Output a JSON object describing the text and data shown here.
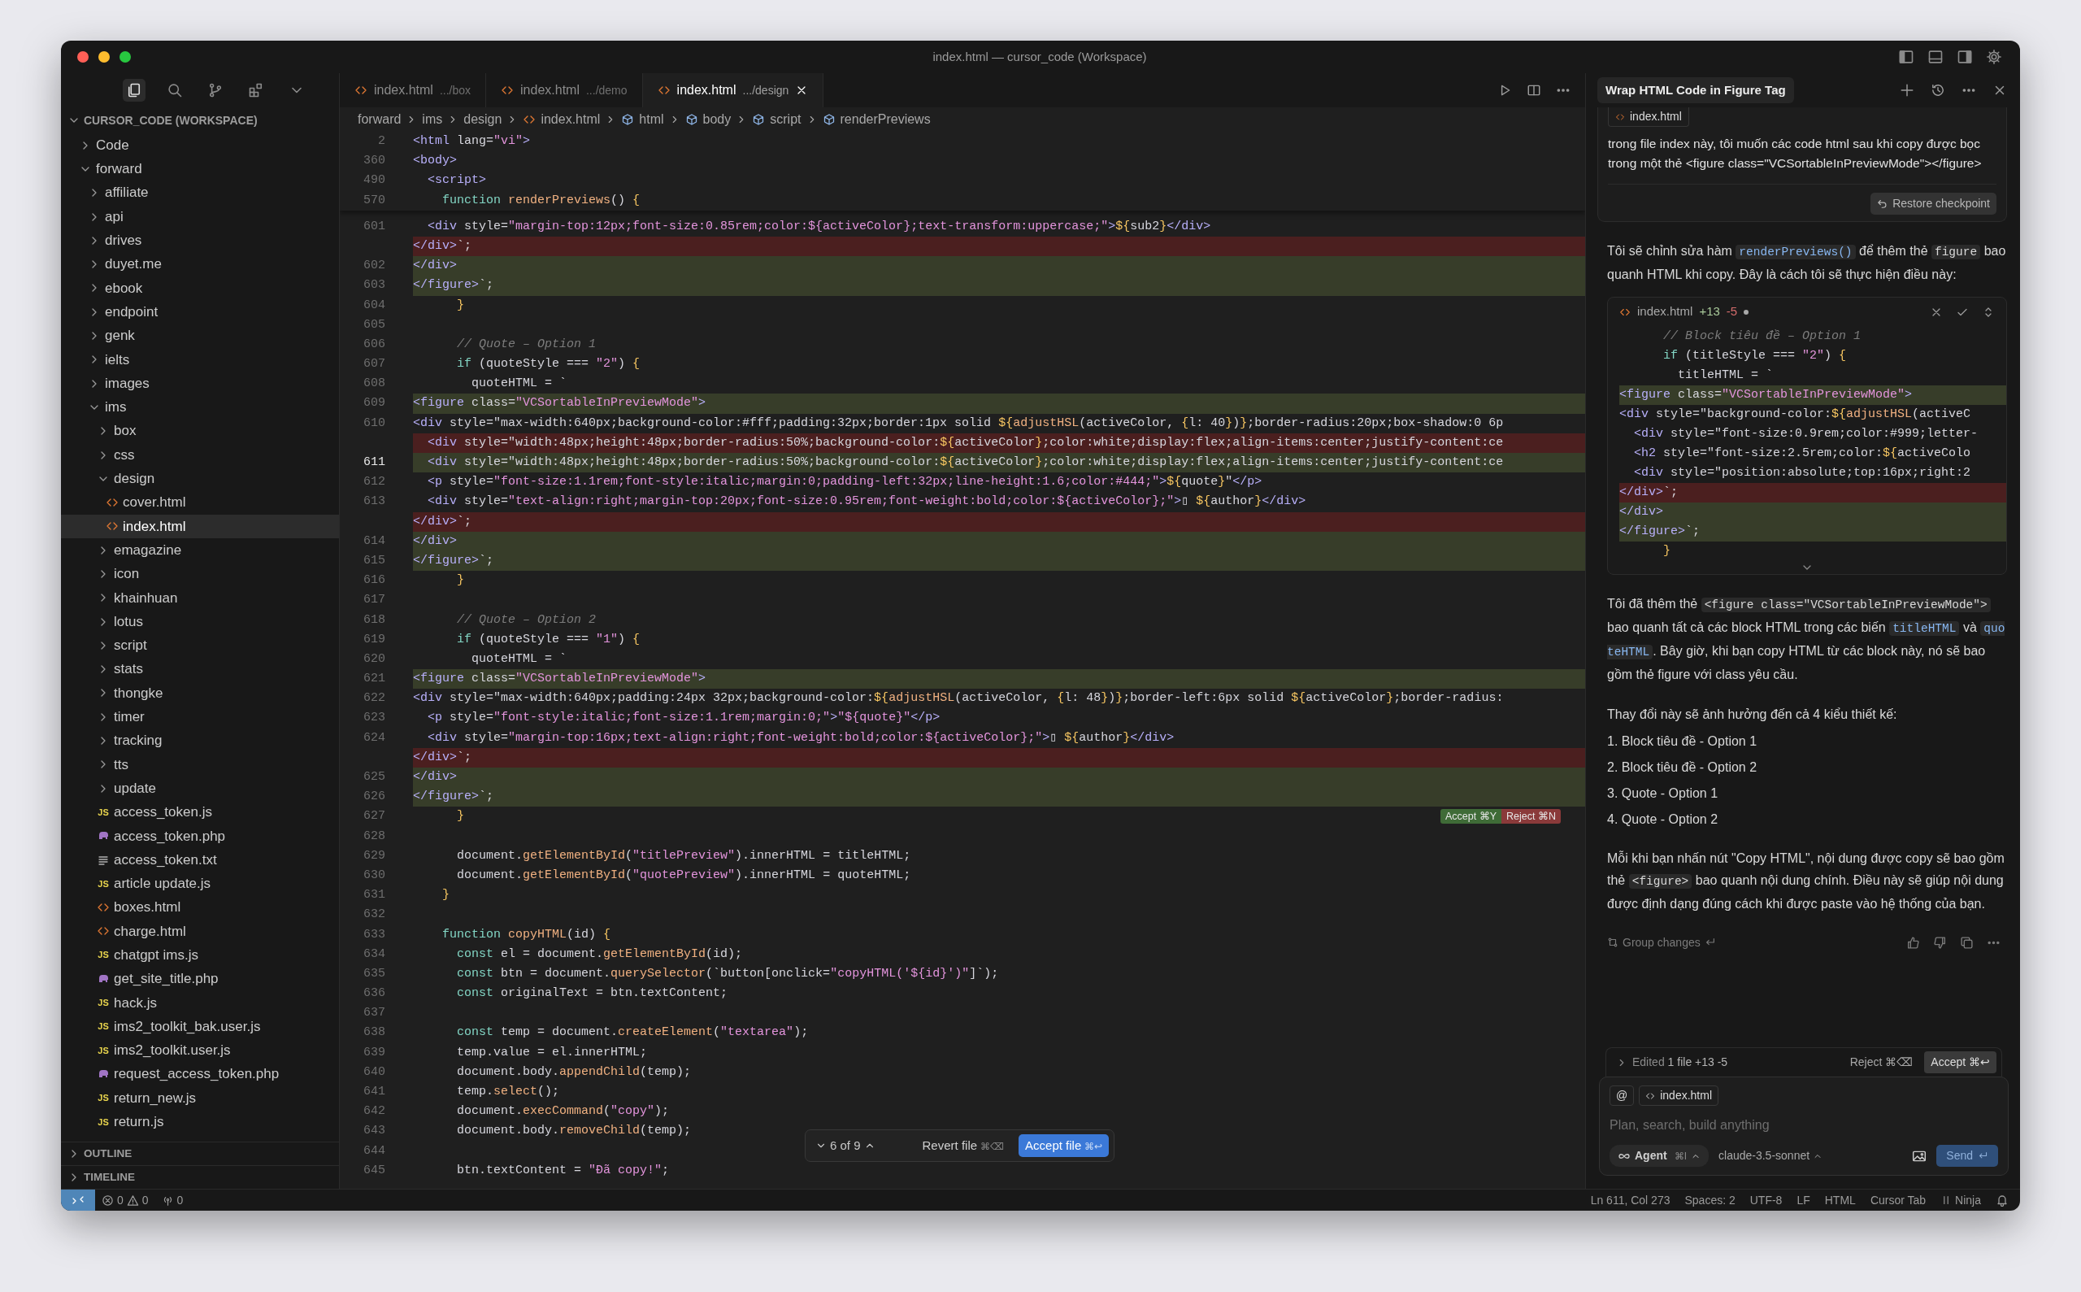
{
  "window": {
    "title": "index.html — cursor_code (Workspace)"
  },
  "activity_bar": [
    {
      "kind": "files",
      "selected": true
    },
    {
      "kind": "search",
      "selected": false
    },
    {
      "kind": "source-control",
      "selected": false
    },
    {
      "kind": "extensions",
      "selected": false
    },
    {
      "kind": "more",
      "selected": false
    }
  ],
  "explorer": {
    "title": "CURSOR_CODE (WORKSPACE)",
    "expanded": true,
    "tree": [
      {
        "label": "Code",
        "kind": "folder",
        "expanded": false,
        "selected": false
      },
      {
        "label": "forward",
        "kind": "folder",
        "expanded": true,
        "selected": false,
        "children": [
          {
            "label": "affiliate",
            "kind": "folder",
            "expanded": false,
            "selected": false
          },
          {
            "label": "api",
            "kind": "folder",
            "expanded": false,
            "selected": false
          },
          {
            "label": "drives",
            "kind": "folder",
            "expanded": false,
            "selected": false
          },
          {
            "label": "duyet.me",
            "kind": "folder",
            "expanded": false,
            "selected": false
          },
          {
            "label": "ebook",
            "kind": "folder",
            "expanded": false,
            "selected": false
          },
          {
            "label": "endpoint",
            "kind": "folder",
            "expanded": false,
            "selected": false
          },
          {
            "label": "genk",
            "kind": "folder",
            "expanded": false,
            "selected": false
          },
          {
            "label": "ielts",
            "kind": "folder",
            "expanded": false,
            "selected": false
          },
          {
            "label": "images",
            "kind": "folder",
            "expanded": false,
            "selected": false
          },
          {
            "label": "ims",
            "kind": "folder",
            "expanded": true,
            "selected": false,
            "children": [
              {
                "label": "box",
                "kind": "folder",
                "expanded": false,
                "selected": false
              },
              {
                "label": "css",
                "kind": "folder",
                "expanded": false,
                "selected": false
              },
              {
                "label": "design",
                "kind": "folder",
                "expanded": true,
                "selected": false,
                "children": [
                  {
                    "label": "cover.html",
                    "kind": "html",
                    "selected": false
                  },
                  {
                    "label": "index.html",
                    "kind": "html",
                    "selected": true
                  }
                ]
              },
              {
                "label": "emagazine",
                "kind": "folder",
                "expanded": false,
                "selected": false
              },
              {
                "label": "icon",
                "kind": "folder",
                "expanded": false,
                "selected": false
              },
              {
                "label": "khainhuan",
                "kind": "folder",
                "expanded": false,
                "selected": false
              },
              {
                "label": "lotus",
                "kind": "folder",
                "expanded": false,
                "selected": false
              },
              {
                "label": "script",
                "kind": "folder",
                "expanded": false,
                "selected": false
              },
              {
                "label": "stats",
                "kind": "folder",
                "expanded": false,
                "selected": false
              },
              {
                "label": "thongke",
                "kind": "folder",
                "expanded": false,
                "selected": false
              },
              {
                "label": "timer",
                "kind": "folder",
                "expanded": false,
                "selected": false
              },
              {
                "label": "tracking",
                "kind": "folder",
                "expanded": false,
                "selected": false
              },
              {
                "label": "tts",
                "kind": "folder",
                "expanded": false,
                "selected": false
              },
              {
                "label": "update",
                "kind": "folder",
                "expanded": false,
                "selected": false
              },
              {
                "label": "access_token.js",
                "kind": "js",
                "icon_label": "JS",
                "selected": false
              },
              {
                "label": "access_token.php",
                "kind": "php",
                "selected": false
              },
              {
                "label": "access_token.txt",
                "kind": "txt",
                "selected": false
              },
              {
                "label": "article update.js",
                "kind": "js",
                "icon_label": "JS",
                "selected": false
              },
              {
                "label": "boxes.html",
                "kind": "html",
                "selected": false
              },
              {
                "label": "charge.html",
                "kind": "html",
                "selected": false
              },
              {
                "label": "chatgpt ims.js",
                "kind": "js",
                "icon_label": "JS",
                "selected": false
              },
              {
                "label": "get_site_title.php",
                "kind": "php",
                "selected": false
              },
              {
                "label": "hack.js",
                "kind": "js",
                "icon_label": "JS",
                "selected": false
              },
              {
                "label": "ims2_toolkit_bak.user.js",
                "kind": "js",
                "icon_label": "JS",
                "selected": false
              },
              {
                "label": "ims2_toolkit.user.js",
                "kind": "js",
                "icon_label": "JS",
                "selected": false
              },
              {
                "label": "request_access_token.php",
                "kind": "php",
                "selected": false
              },
              {
                "label": "return_new.js",
                "kind": "js",
                "icon_label": "JS",
                "selected": false
              },
              {
                "label": "return.js",
                "kind": "js",
                "icon_label": "JS",
                "selected": false
              }
            ]
          }
        ]
      }
    ],
    "sections": [
      {
        "title": "OUTLINE",
        "expanded": false
      },
      {
        "title": "TIMELINE",
        "expanded": false
      }
    ]
  },
  "tabs": [
    {
      "name": "index.html",
      "path": ".../box",
      "selected": false
    },
    {
      "name": "index.html",
      "path": ".../demo",
      "selected": false
    },
    {
      "name": "index.html",
      "path": ".../design",
      "selected": true
    }
  ],
  "breadcrumbs": [
    {
      "label": "forward",
      "kind": "folder"
    },
    {
      "label": "ims",
      "kind": "folder"
    },
    {
      "label": "design",
      "kind": "folder"
    },
    {
      "label": "index.html",
      "kind": "file"
    },
    {
      "label": "html",
      "kind": "element"
    },
    {
      "label": "body",
      "kind": "element"
    },
    {
      "label": "script",
      "kind": "element"
    },
    {
      "label": "renderPreviews",
      "kind": "element"
    }
  ],
  "editor": {
    "sticky_lines": [
      {
        "num": "2",
        "text": "<html lang=\"vi\">"
      },
      {
        "num": "360",
        "text": "<body>"
      },
      {
        "num": "490",
        "text": "  <script>"
      },
      {
        "num": "570",
        "text": "    function renderPreviews() {"
      }
    ],
    "lines": [
      {
        "num": "601",
        "text": "  <div style=\"margin-top:12px;font-size:0.85rem;color:${activeColor};text-transform:uppercase;\">${sub2}</div>",
        "added": false,
        "removed": false,
        "current": false
      },
      {
        "text": "</div>`;",
        "added": false,
        "removed": true
      },
      {
        "num": "602",
        "text": "</div>",
        "added": true,
        "removed": false,
        "current": false
      },
      {
        "num": "603",
        "text": "</figure>`;",
        "added": true,
        "removed": false,
        "current": false
      },
      {
        "num": "604",
        "text": "      }",
        "added": false,
        "removed": false,
        "current": false
      },
      {
        "num": "605",
        "added": false,
        "removed": false,
        "current": false
      },
      {
        "num": "606",
        "text": "      // Quote – Option 1",
        "added": false,
        "removed": false,
        "current": false
      },
      {
        "num": "607",
        "text": "      if (quoteStyle === \"2\") {",
        "added": false,
        "removed": false,
        "current": false
      },
      {
        "num": "608",
        "text": "        quoteHTML = `",
        "added": false,
        "removed": false,
        "current": false
      },
      {
        "num": "609",
        "text": "<figure class=\"VCSortableInPreviewMode\">",
        "added": true,
        "removed": false,
        "current": false
      },
      {
        "num": "610",
        "text": "<div style=\"max-width:640px;background-color:#fff;padding:32px;border:1px solid ${adjustHSL(activeColor, {l: 40})};border-radius:20px;box-shadow:0 6p",
        "added": false,
        "removed": false,
        "current": false
      },
      {
        "text": "  <div style=\"width:48px;height:48px;border-radius:50%;background-color:${activeColor};color:white;display:flex;align-items:center;justify-content:ce",
        "added": false,
        "removed": true
      },
      {
        "num": "611",
        "text": "  <div style=\"width:48px;height:48px;border-radius:50%;background-color:${activeColor};color:white;display:flex;align-items:center;justify-content:ce",
        "added": true,
        "removed": false,
        "current": true
      },
      {
        "num": "612",
        "text": "  <p style=\"font-size:1.1rem;font-style:italic;margin:0;padding-left:32px;line-height:1.6;color:#444;\">${quote}\"</p>",
        "added": false,
        "removed": false,
        "current": false
      },
      {
        "num": "613",
        "text": "  <div style=\"text-align:right;margin-top:20px;font-size:0.95rem;font-weight:bold;color:${activeColor};\">▯ ${author}</div>",
        "added": false,
        "removed": false,
        "current": false
      },
      {
        "text": "</div>`;",
        "added": false,
        "removed": true
      },
      {
        "num": "614",
        "text": "</div>",
        "added": true,
        "removed": false,
        "current": false
      },
      {
        "num": "615",
        "text": "</figure>`;",
        "added": true,
        "removed": false,
        "current": false
      },
      {
        "num": "616",
        "text": "      }",
        "added": false,
        "removed": false,
        "current": false
      },
      {
        "num": "617",
        "added": false,
        "removed": false,
        "current": false
      },
      {
        "num": "618",
        "text": "      // Quote – Option 2",
        "added": false,
        "removed": false,
        "current": false
      },
      {
        "num": "619",
        "text": "      if (quoteStyle === \"1\") {",
        "added": false,
        "removed": false,
        "current": false
      },
      {
        "num": "620",
        "text": "        quoteHTML = `",
        "added": false,
        "removed": false,
        "current": false
      },
      {
        "num": "621",
        "text": "<figure class=\"VCSortableInPreviewMode\">",
        "added": true,
        "removed": false,
        "current": false
      },
      {
        "num": "622",
        "text": "<div style=\"max-width:640px;padding:24px 32px;background-color:${adjustHSL(activeColor, {l: 48})};border-left:6px solid ${activeColor};border-radius:",
        "added": false,
        "removed": false,
        "current": false
      },
      {
        "num": "623",
        "text": "  <p style=\"font-style:italic;font-size:1.1rem;margin:0;\">\"${quote}\"</p>",
        "added": false,
        "removed": false,
        "current": false
      },
      {
        "num": "624",
        "text": "  <div style=\"margin-top:16px;text-align:right;font-weight:bold;color:${activeColor};\">▯ ${author}</div>",
        "added": false,
        "removed": false,
        "current": false
      },
      {
        "text": "</div>`;",
        "added": false,
        "removed": true
      },
      {
        "num": "625",
        "text": "</div>",
        "added": true,
        "removed": false,
        "current": false
      },
      {
        "num": "626",
        "text": "</figure>`;",
        "added": true,
        "removed": false,
        "current": false
      },
      {
        "num": "627",
        "text": "      }",
        "added": false,
        "removed": false,
        "current": false,
        "actions": [
          {
            "kind": "accept",
            "label": "Accept ⌘Y"
          },
          {
            "kind": "reject",
            "label": "Reject ⌘N"
          }
        ]
      },
      {
        "num": "628",
        "added": false,
        "removed": false,
        "current": false
      },
      {
        "num": "629",
        "text": "      document.getElementById(\"titlePreview\").innerHTML = titleHTML;",
        "added": false,
        "removed": false,
        "current": false
      },
      {
        "num": "630",
        "text": "      document.getElementById(\"quotePreview\").innerHTML = quoteHTML;",
        "added": false,
        "removed": false,
        "current": false
      },
      {
        "num": "631",
        "text": "    }",
        "added": false,
        "removed": false,
        "current": false
      },
      {
        "num": "632",
        "added": false,
        "removed": false,
        "current": false
      },
      {
        "num": "633",
        "text": "    function copyHTML(id) {",
        "added": false,
        "removed": false,
        "current": false
      },
      {
        "num": "634",
        "text": "      const el = document.getElementById(id);",
        "added": false,
        "removed": false,
        "current": false
      },
      {
        "num": "635",
        "text": "      const btn = document.querySelector(`button[onclick=\"copyHTML('${id}')\"]`);",
        "added": false,
        "removed": false,
        "current": false
      },
      {
        "num": "636",
        "text": "      const originalText = btn.textContent;",
        "added": false,
        "removed": false,
        "current": false
      },
      {
        "num": "637",
        "added": false,
        "removed": false,
        "current": false
      },
      {
        "num": "638",
        "text": "      const temp = document.createElement(\"textarea\");",
        "added": false,
        "removed": false,
        "current": false
      },
      {
        "num": "639",
        "text": "      temp.value = el.innerHTML;",
        "added": false,
        "removed": false,
        "current": false
      },
      {
        "num": "640",
        "text": "      document.body.appendChild(temp);",
        "added": false,
        "removed": false,
        "current": false
      },
      {
        "num": "641",
        "text": "      temp.select();",
        "added": false,
        "removed": false,
        "current": false
      },
      {
        "num": "642",
        "text": "      document.execCommand(\"copy\");",
        "added": false,
        "removed": false,
        "current": false
      },
      {
        "num": "643",
        "text": "      document.body.removeChild(temp);",
        "added": false,
        "removed": false,
        "current": false
      },
      {
        "num": "644",
        "added": false,
        "removed": false,
        "current": false
      },
      {
        "num": "645",
        "text": "      btn.textContent = \"Đã copy!\";",
        "added": false,
        "removed": false,
        "current": false
      }
    ],
    "diff_nav": {
      "position": "6 of 9",
      "revert": {
        "label": "Revert file",
        "shortcut": "⌘⌫"
      },
      "accept": {
        "label": "Accept file",
        "shortcut": "⌘↩"
      }
    }
  },
  "chat": {
    "title": "Wrap HTML Code in Figure Tag",
    "user_message": {
      "file_chip": "index.html",
      "text": "trong file index này, tôi muốn các code html sau khi copy được bọc trong một thẻ <figure class=\"VCSortableInPreviewMode\"></figure>",
      "restore": "Restore checkpoint"
    },
    "assistant": [
      {
        "kind": "paragraph",
        "parts": [
          {
            "kind": "text",
            "text": "Tôi sẽ chỉnh sửa hàm "
          },
          {
            "kind": "symbol",
            "text": "renderPreviews()"
          },
          {
            "kind": "text",
            "text": " để thêm thẻ "
          },
          {
            "kind": "code",
            "text": "figure"
          },
          {
            "kind": "text",
            "text": " bao quanh HTML khi copy. Đây là cách tôi sẽ thực hiện điều này:"
          }
        ]
      },
      {
        "kind": "code_block",
        "file": "index.html",
        "added": "+13",
        "removed": "-5",
        "lines": [
          {
            "text": "      // Block tiêu đề – Option 1",
            "added": false,
            "removed": false
          },
          {
            "text": "      if (titleStyle === \"2\") {",
            "added": false,
            "removed": false
          },
          {
            "text": "        titleHTML = `",
            "added": false,
            "removed": false
          },
          {
            "text": "<figure class=\"VCSortableInPreviewMode\">",
            "added": true,
            "removed": false
          },
          {
            "text": "<div style=\"background-color:${adjustHSL(activeC",
            "added": false,
            "removed": false
          },
          {
            "text": "  <div style=\"font-size:0.9rem;color:#999;letter-",
            "added": false,
            "removed": false
          },
          {
            "text": "  <h2 style=\"font-size:2.5rem;color:${activeColo",
            "added": false,
            "removed": false
          },
          {
            "text": "  <div style=\"position:absolute;top:16px;right:2",
            "added": false,
            "removed": false
          },
          {
            "text": "</div>`;",
            "added": false,
            "removed": true
          },
          {
            "text": "</div>",
            "added": true,
            "removed": false
          },
          {
            "text": "</figure>`;",
            "added": true,
            "removed": false
          },
          {
            "text": "      }",
            "added": false,
            "removed": false
          }
        ]
      },
      {
        "kind": "paragraph",
        "parts": [
          {
            "kind": "text",
            "text": "Tôi đã thêm thẻ "
          },
          {
            "kind": "code",
            "text": "<figure class=\"VCSortableInPreviewMode\">"
          },
          {
            "kind": "text",
            "text": " bao quanh tất cả các block HTML trong các biến "
          },
          {
            "kind": "symbol",
            "text": "titleHTML"
          },
          {
            "kind": "text",
            "text": " và "
          },
          {
            "kind": "symbol",
            "text": "quoteHTML"
          },
          {
            "kind": "text",
            "text": ". Bây giờ, khi bạn copy HTML từ các block này, nó sẽ bao gồm thẻ figure với class yêu cầu."
          }
        ]
      },
      {
        "kind": "paragraph",
        "parts": [
          {
            "kind": "text",
            "text": "Thay đổi này sẽ ảnh hưởng đến cả 4 kiểu thiết kế:"
          }
        ]
      },
      {
        "kind": "list_item",
        "text": "1. Block tiêu đề - Option 1"
      },
      {
        "kind": "list_item",
        "text": "2. Block tiêu đề - Option 2"
      },
      {
        "kind": "list_item",
        "text": "3. Quote - Option 1"
      },
      {
        "kind": "list_item",
        "text": "4. Quote - Option 2"
      },
      {
        "kind": "paragraph",
        "parts": [
          {
            "kind": "text",
            "text": "Mỗi khi bạn nhấn nút \"Copy HTML\", nội dung được copy sẽ bao gồm thẻ "
          },
          {
            "kind": "code",
            "text": "<figure>"
          },
          {
            "kind": "text",
            "text": " bao quanh nội dung chính. Điều này sẽ giúp nội dung được định dạng đúng cách khi được paste vào hệ thống của bạn."
          }
        ]
      }
    ],
    "group_changes": "Group changes",
    "edited_bar": {
      "label": "Edited",
      "summary": "1 file +13 -5",
      "reject": "Reject ⌘⌫",
      "accept": "Accept ⌘↩"
    },
    "composer": {
      "chips": [
        {
          "kind": "mention",
          "label": "@"
        },
        {
          "kind": "file",
          "label": "index.html"
        }
      ],
      "placeholder": "Plan, search, build anything",
      "mode": {
        "label": "Agent",
        "shortcut": "⌘I"
      },
      "model": "claude-3.5-sonnet",
      "send": "Send"
    }
  },
  "status_bar": {
    "errors": "0",
    "warnings": "0",
    "ports": "0",
    "items": [
      {
        "kind": "plain",
        "label": "Ln 611, Col 273"
      },
      {
        "kind": "plain",
        "label": "Spaces: 2"
      },
      {
        "kind": "plain",
        "label": "UTF-8"
      },
      {
        "kind": "plain",
        "label": "LF"
      },
      {
        "kind": "plain",
        "label": "HTML"
      },
      {
        "kind": "plain",
        "label": "Cursor Tab"
      },
      {
        "kind": "ninja",
        "label": "Ninja"
      }
    ]
  }
}
